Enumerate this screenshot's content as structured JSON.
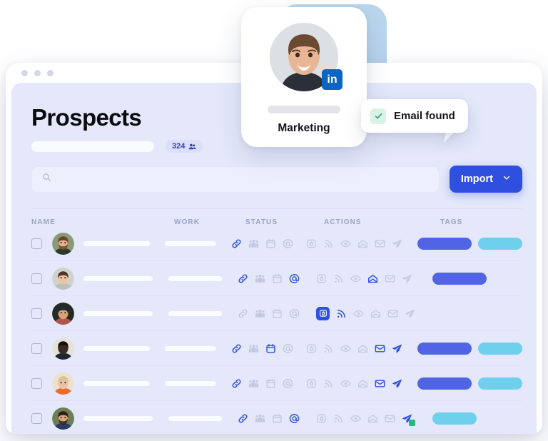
{
  "window": {
    "dots": 3
  },
  "header": {
    "title": "Prospects",
    "count_badge": {
      "value": "324",
      "icon": "people-icon"
    }
  },
  "search": {
    "placeholder": "",
    "icon": "search-icon"
  },
  "import": {
    "label": "Import",
    "caret_icon": "chevron-down-icon",
    "color": "#2f50df"
  },
  "table": {
    "columns": [
      "NAME",
      "WORK",
      "STATUS",
      "ACTIONS",
      "TAGS"
    ],
    "status_icons": [
      "link-icon",
      "people-icon",
      "calendar-icon",
      "at-icon"
    ],
    "action_icons": [
      "tag-icon",
      "rss-icon",
      "eye-icon",
      "envelope-open-icon",
      "envelope-icon",
      "send-icon"
    ],
    "rows": [
      {
        "checked": false,
        "avatar_alt": "bearded-man-avatar",
        "status_active": [
          true,
          false,
          false,
          false
        ],
        "actions_active": [
          false,
          false,
          false,
          false,
          false,
          false
        ],
        "actions_boxed": [
          false,
          false,
          false,
          false,
          false,
          false
        ],
        "send_badge": false,
        "tags": [
          {
            "color": "blue",
            "width": "w76"
          },
          {
            "color": "cyan",
            "width": "w62"
          }
        ]
      },
      {
        "checked": false,
        "avatar_alt": "curly-hair-woman-avatar",
        "status_active": [
          true,
          false,
          false,
          true
        ],
        "actions_active": [
          false,
          false,
          false,
          true,
          false,
          false
        ],
        "actions_boxed": [
          false,
          false,
          false,
          false,
          false,
          false
        ],
        "send_badge": false,
        "tags": [
          {
            "color": "blue",
            "width": "w76"
          }
        ]
      },
      {
        "checked": false,
        "avatar_alt": "cap-man-avatar",
        "status_active": [
          false,
          false,
          false,
          false
        ],
        "actions_active": [
          false,
          true,
          false,
          false,
          false,
          false
        ],
        "actions_boxed": [
          true,
          false,
          false,
          false,
          false,
          false
        ],
        "send_badge": false,
        "tags": []
      },
      {
        "checked": false,
        "avatar_alt": "dark-portrait-avatar",
        "status_active": [
          true,
          false,
          true,
          false
        ],
        "actions_active": [
          false,
          false,
          false,
          false,
          true,
          true
        ],
        "actions_boxed": [
          false,
          false,
          false,
          false,
          false,
          false
        ],
        "send_badge": false,
        "tags": [
          {
            "color": "blue",
            "width": "w76"
          },
          {
            "color": "cyan",
            "width": "w62"
          }
        ]
      },
      {
        "checked": false,
        "avatar_alt": "blonde-woman-avatar",
        "status_active": [
          true,
          false,
          false,
          false
        ],
        "actions_active": [
          false,
          false,
          false,
          false,
          true,
          true
        ],
        "actions_boxed": [
          false,
          false,
          false,
          false,
          false,
          false
        ],
        "send_badge": false,
        "tags": [
          {
            "color": "blue",
            "width": "w76"
          },
          {
            "color": "cyan",
            "width": "w62"
          }
        ]
      },
      {
        "checked": false,
        "avatar_alt": "outdoor-man-avatar",
        "status_active": [
          true,
          false,
          false,
          true
        ],
        "actions_active": [
          false,
          false,
          false,
          false,
          false,
          true
        ],
        "actions_boxed": [
          false,
          false,
          false,
          false,
          false,
          false
        ],
        "send_badge": true,
        "tags": [
          {
            "color": "cyan",
            "width": "w62"
          }
        ]
      }
    ]
  },
  "profile_card": {
    "department": "Marketing",
    "social_badge": "linkedin-icon",
    "social_letters": "in",
    "photo_alt": "smiling-man-photo"
  },
  "toast": {
    "label": "Email found",
    "icon": "check-icon",
    "icon_color": "#2ea37a"
  },
  "colors": {
    "accent": "#2f50df",
    "tag_blue": "#5064e4",
    "tag_cyan": "#6fd0ee",
    "app_bg": "#e4e8fa",
    "panel_blue": "#b9d6ec"
  }
}
